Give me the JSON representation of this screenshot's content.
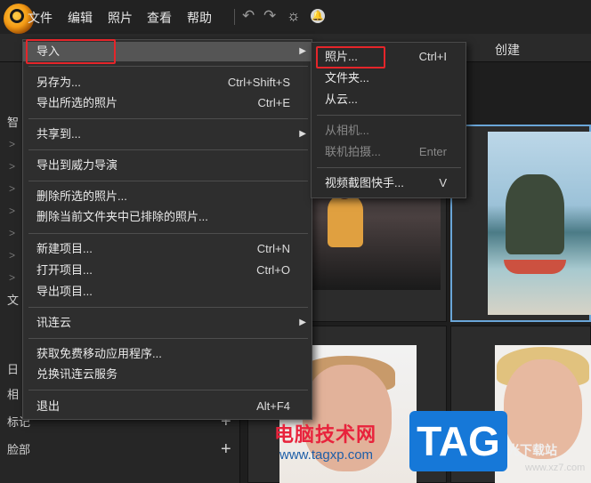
{
  "menubar": {
    "items": [
      "文件",
      "编辑",
      "照片",
      "查看",
      "帮助"
    ],
    "icons": [
      "undo-icon",
      "redo-icon",
      "gear-icon",
      "bell-icon"
    ]
  },
  "modes": [
    "创建"
  ],
  "left_panel": {
    "rows": [
      "智",
      "文",
      "日",
      "相",
      "标记",
      "脸部"
    ]
  },
  "file_menu": {
    "items": [
      {
        "label": "导入",
        "shortcut": "",
        "submenu": true
      },
      {
        "label": "另存为...",
        "shortcut": "Ctrl+Shift+S"
      },
      {
        "label": "导出所选的照片",
        "shortcut": "Ctrl+E"
      },
      {
        "label": "共享到...",
        "shortcut": "",
        "submenu": true
      },
      {
        "label": "导出到威力导演",
        "shortcut": ""
      },
      {
        "label": "删除所选的照片...",
        "shortcut": ""
      },
      {
        "label": "删除当前文件夹中已排除的照片...",
        "shortcut": ""
      },
      {
        "label": "新建项目...",
        "shortcut": "Ctrl+N"
      },
      {
        "label": "打开项目...",
        "shortcut": "Ctrl+O"
      },
      {
        "label": "导出项目...",
        "shortcut": ""
      },
      {
        "label": "讯连云",
        "shortcut": "",
        "submenu": true
      },
      {
        "label": "获取免费移动应用程序...",
        "shortcut": ""
      },
      {
        "label": "兑换讯连云服务",
        "shortcut": ""
      },
      {
        "label": "退出",
        "shortcut": "Alt+F4"
      }
    ]
  },
  "import_submenu": {
    "items": [
      {
        "label": "照片...",
        "shortcut": "Ctrl+I",
        "enabled": true
      },
      {
        "label": "文件夹...",
        "shortcut": "",
        "enabled": true
      },
      {
        "label": "从云...",
        "shortcut": "",
        "enabled": true
      },
      {
        "label": "从相机...",
        "shortcut": "",
        "enabled": false
      },
      {
        "label": "联机拍摄...",
        "shortcut": "Enter",
        "enabled": false
      },
      {
        "label": "视频截图快手...",
        "shortcut": "V",
        "enabled": true
      }
    ]
  },
  "watermark": {
    "title": "电脑技术网",
    "url": "www.tagxp.com",
    "tag": "TAG",
    "site": "光下载站",
    "site_url": "www.xz7.com"
  },
  "colors": {
    "highlight": "#e5252a",
    "selection": "#6aa6d8",
    "accent": "#1678d8"
  }
}
